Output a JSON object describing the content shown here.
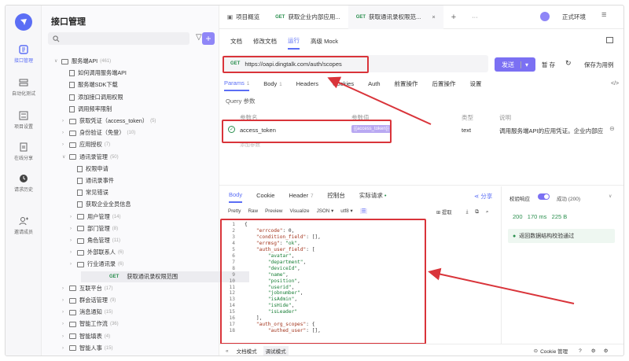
{
  "app_title": "接口管理",
  "rail": [
    {
      "label": "接口管理",
      "icon": "api-icon",
      "active": true
    },
    {
      "label": "自动化测试",
      "icon": "automation-icon"
    },
    {
      "label": "项目设置",
      "icon": "settings-icon"
    },
    {
      "label": "在线分享",
      "icon": "share-icon"
    },
    {
      "label": "请求历史",
      "icon": "history-icon"
    },
    {
      "label": "邀请成员",
      "icon": "invite-icon"
    }
  ],
  "tree": [
    {
      "label": "服务端API",
      "count": "(461)",
      "kind": "folder",
      "open": true
    },
    {
      "label": "如何调用服务端API",
      "kind": "doc"
    },
    {
      "label": "服务端SDK下载",
      "kind": "doc"
    },
    {
      "label": "添加接口调用权限",
      "kind": "doc"
    },
    {
      "label": "调用频率限制",
      "kind": "doc"
    },
    {
      "label": "获取凭证（access_token）",
      "count": "(5)",
      "kind": "folder"
    },
    {
      "label": "身份验证（免登）",
      "count": "(10)",
      "kind": "folder"
    },
    {
      "label": "应用授权",
      "count": "(7)",
      "kind": "folder"
    },
    {
      "label": "通讯录管理",
      "count": "(50)",
      "kind": "folder",
      "open": true
    },
    {
      "label": "权限申请",
      "kind": "doc"
    },
    {
      "label": "通讯录事件",
      "kind": "doc"
    },
    {
      "label": "常见错误",
      "kind": "doc"
    },
    {
      "label": "获取企业全员信息",
      "kind": "doc"
    },
    {
      "label": "用户管理",
      "count": "(14)",
      "kind": "folder"
    },
    {
      "label": "部门管理",
      "count": "(8)",
      "kind": "folder"
    },
    {
      "label": "角色管理",
      "count": "(11)",
      "kind": "folder"
    },
    {
      "label": "外部联系人",
      "count": "(6)",
      "kind": "folder"
    },
    {
      "label": "行业通讯录",
      "count": "(6)",
      "kind": "folder"
    },
    {
      "label": "获取通讯录权限范围",
      "method": "GET",
      "kind": "api",
      "selected": true
    },
    {
      "label": "互联平台",
      "count": "(17)",
      "kind": "folder"
    },
    {
      "label": "群会话管理",
      "count": "(9)",
      "kind": "folder"
    },
    {
      "label": "消息通知",
      "count": "(15)",
      "kind": "folder"
    },
    {
      "label": "智能工作流",
      "count": "(36)",
      "kind": "folder"
    },
    {
      "label": "智能填表",
      "count": "(4)",
      "kind": "folder"
    },
    {
      "label": "智能人事",
      "count": "(15)",
      "kind": "folder"
    }
  ],
  "top_tabs": [
    {
      "label": "项目概览",
      "method": ""
    },
    {
      "label": "获取企业内部应用...",
      "method": "GET"
    },
    {
      "label": "获取通讯录权限范...",
      "method": "GET",
      "active": true
    }
  ],
  "env_label": "正式环境",
  "sub_tabs": [
    "文档",
    "修改文档",
    "运行",
    "高级 Mock"
  ],
  "url": {
    "method": "GET",
    "value": "https://oapi.dingtalk.com/auth/scopes"
  },
  "buttons": {
    "send": "发送",
    "pause": "暂 存",
    "save_case": "保存为用例"
  },
  "param_tabs": [
    {
      "label": "Params",
      "count": "1",
      "active": true
    },
    {
      "label": "Body",
      "count": "1"
    },
    {
      "label": "Headers",
      "count": ""
    },
    {
      "label": "Cookies",
      "count": ""
    },
    {
      "label": "Auth",
      "count": ""
    },
    {
      "label": "前置操作",
      "count": ""
    },
    {
      "label": "后置操作",
      "count": ""
    },
    {
      "label": "设置",
      "count": ""
    }
  ],
  "query": {
    "section": "Query 参数",
    "headers": [
      "参数名",
      "参数值",
      "类型",
      "说明"
    ],
    "row": {
      "name": "access_token",
      "value": "{{access_token}}",
      "type": "text",
      "desc": "调用服务端API的应用凭证。企业内部应"
    },
    "add_placeholder": "添加参数"
  },
  "response_tabs": [
    {
      "label": "Body",
      "count": "",
      "active": true
    },
    {
      "label": "Cookie",
      "count": ""
    },
    {
      "label": "Header",
      "count": "7"
    },
    {
      "label": "控制台",
      "count": ""
    },
    {
      "label": "实际请求",
      "count": ""
    }
  ],
  "share_label": "分享",
  "format_bar": [
    "Pretty",
    "Raw",
    "Preview",
    "Visualize",
    "JSON ▾",
    "utf8 ▾"
  ],
  "extract_label": "提取",
  "code_lines": [
    "{",
    "    \"errcode\": 0,",
    "    \"condition_field\": [],",
    "    \"errmsg\": \"ok\",",
    "    \"auth_user_field\": [",
    "        \"avatar\",",
    "        \"department\",",
    "        \"deviceId\",",
    "        \"name\",",
    "        \"position\",",
    "        \"userid\",",
    "        \"jobnumber\",",
    "        \"isAdmin\",",
    "        \"isHide\",",
    "        \"isLeader\"",
    "    ],",
    "    \"auth_org_scopes\": {",
    "        \"authed_user\": [],"
  ],
  "validation": {
    "label": "校验响应",
    "status": "成功 (200)",
    "status_code": "200",
    "time": "170 ms",
    "size": "225 B",
    "message": "返回数据结构校验通过"
  },
  "bottom_bar": {
    "doc_mode": "文档模式",
    "debug_mode": "调试模式",
    "cookie": "Cookie 管理"
  }
}
